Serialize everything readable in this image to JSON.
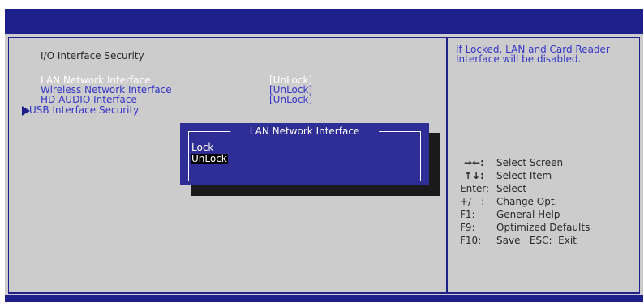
{
  "main_panel": {
    "section_title": "I/O Interface Security",
    "items": [
      {
        "label": "LAN Network Interface",
        "value": "[UnLock]"
      },
      {
        "label": "Wireless Network Interface",
        "value": "[UnLock]"
      },
      {
        "label": "HD AUDIO Interface",
        "value": "[UnLock]"
      }
    ],
    "submenu": {
      "label": "USB Interface Security"
    }
  },
  "help_panel": {
    "description": [
      "If Locked, LAN and Card Reader",
      "Interface will be disabled."
    ],
    "keys": [
      {
        "key": "→←:",
        "desc": "Select Screen"
      },
      {
        "key": "↑↓:",
        "desc": "Select Item"
      },
      {
        "key": "Enter:",
        "desc": "Select"
      },
      {
        "key": "+/—:",
        "desc": "Change Opt."
      },
      {
        "key": "F1:",
        "desc": "General Help"
      },
      {
        "key": "F9:",
        "desc": "Optimized Defaults"
      },
      {
        "key": "F10:",
        "desc": "Save   ESC:  Exit"
      }
    ]
  },
  "popup": {
    "title": "LAN Network Interface",
    "options": [
      "Lock",
      "UnLock"
    ],
    "selected": "UnLock"
  },
  "colors": {
    "bios_blue": "#1f1f8c",
    "panel_gray": "#cccccc",
    "highlight_text": "#ffffff",
    "item_text": "#3434c8",
    "popup_bg": "#2e2e96"
  }
}
